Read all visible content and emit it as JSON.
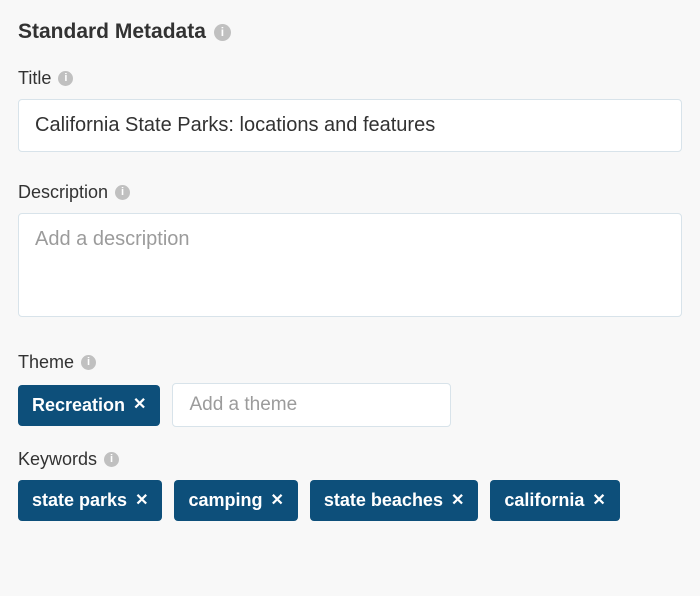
{
  "section": {
    "header": "Standard Metadata"
  },
  "title": {
    "label": "Title",
    "value": "California State Parks: locations and features"
  },
  "description": {
    "label": "Description",
    "placeholder": "Add a description",
    "value": ""
  },
  "theme": {
    "label": "Theme",
    "placeholder": "Add a theme",
    "tags": [
      "Recreation"
    ]
  },
  "keywords": {
    "label": "Keywords",
    "tags": [
      "state parks",
      "camping",
      "state beaches",
      "california"
    ]
  }
}
